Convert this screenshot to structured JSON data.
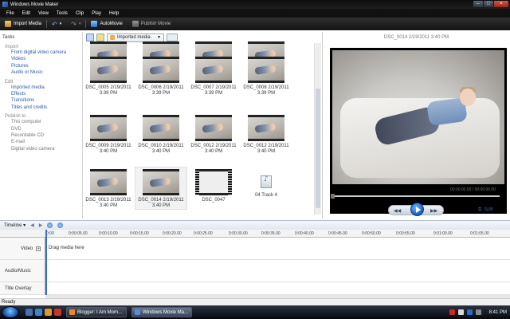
{
  "window": {
    "title": "Windows Movie Maker"
  },
  "menu": [
    "File",
    "Edit",
    "View",
    "Tools",
    "Clip",
    "Play",
    "Help"
  ],
  "toolbar": {
    "import_label": "Import Media",
    "automovie_label": "AutoMovie",
    "publish_label": "Publish Movie"
  },
  "tasks": {
    "header": "Tasks",
    "sections": [
      {
        "title": "Import",
        "links": [
          "From digital video camera",
          "Videos",
          "Pictures",
          "Audio or Music"
        ],
        "muted": false
      },
      {
        "title": "Edit",
        "links": [
          "Imported media",
          "Effects",
          "Transitions",
          "Titles and credits"
        ],
        "muted": false
      },
      {
        "title": "Publish to",
        "links": [
          "This computer",
          "DVD",
          "Recordable CD",
          "E-mail",
          "Digital video camera"
        ],
        "muted": true
      }
    ]
  },
  "collection": {
    "selected": "Imported media"
  },
  "media_items": [
    {
      "label": "PM",
      "kind": "video"
    },
    {
      "label": "PM",
      "kind": "video"
    },
    {
      "label": "PM",
      "kind": "video"
    },
    {
      "label": "PM",
      "kind": "video"
    },
    {
      "label": "DSC_0005 2/19/2011 3:39 PM",
      "kind": "video"
    },
    {
      "label": "DSC_0006 2/19/2011 3:39 PM",
      "kind": "video"
    },
    {
      "label": "DSC_0007 2/19/2011 3:39 PM",
      "kind": "video"
    },
    {
      "label": "DSC_0008 2/19/2011 3:39 PM",
      "kind": "video"
    },
    {
      "label": "DSC_0009 2/19/2011 3:40 PM",
      "kind": "video"
    },
    {
      "label": "DSC_0010 2/19/2011 3:40 PM",
      "kind": "video"
    },
    {
      "label": "DSC_0012 2/19/2011 3:40 PM",
      "kind": "video"
    },
    {
      "label": "DSC_0012 2/19/2011 3:40 PM",
      "kind": "video"
    },
    {
      "label": "DSC_0013 2/19/2011 3:40 PM",
      "kind": "video"
    },
    {
      "label": "DSC_0014 2/19/2011 3:40 PM",
      "kind": "video",
      "selected": true
    },
    {
      "label": "DSC_0047",
      "kind": "photo"
    },
    {
      "label": "04 Track 4",
      "kind": "audio"
    }
  ],
  "preview": {
    "title": "DSC_0014 2/19/2011 3:40 PM",
    "time": "00:00:00.00 / 00:00:00.00",
    "split_label": "Split"
  },
  "timeline": {
    "label": "Timeline",
    "ticks": [
      "0:00:05.00",
      "0:00:10.00",
      "0:00:15.00",
      "0:00:20.00",
      "0:00:25.00",
      "0:00:30.00",
      "0:00:35.00",
      "0:00:40.00",
      "0:00:45.00",
      "0:00:50.00",
      "0:00:55.00",
      "0:01:00.00",
      "0:01:05.00"
    ],
    "start_tick": "0:00",
    "tracks": [
      "Video",
      "Audio/Music",
      "Title Overlay"
    ],
    "drop_hint": "Drag media here"
  },
  "status": "Ready",
  "taskbar": {
    "tasks": [
      {
        "label": "Blogger: I Am Mom...",
        "active": false
      },
      {
        "label": "Windows Movie Ma...",
        "active": true
      }
    ],
    "clock": "8:41 PM"
  }
}
